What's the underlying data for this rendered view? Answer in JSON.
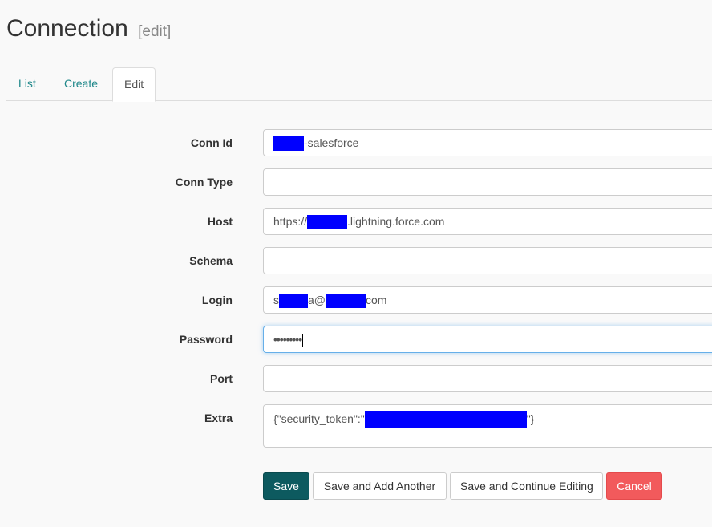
{
  "header": {
    "title": "Connection",
    "subtitle": "[edit]"
  },
  "tabs": [
    {
      "label": "List"
    },
    {
      "label": "Create"
    },
    {
      "label": "Edit"
    }
  ],
  "form": {
    "conn_id": {
      "label": "Conn Id",
      "value_suffix": "-salesforce"
    },
    "conn_type": {
      "label": "Conn Type",
      "value": ""
    },
    "host": {
      "label": "Host",
      "value_prefix": "https://",
      "value_suffix": ".lightning.force.com"
    },
    "schema": {
      "label": "Schema",
      "value": ""
    },
    "login": {
      "label": "Login",
      "value_prefix": "s",
      "value_middle": "a@",
      "value_suffix": "com"
    },
    "password": {
      "label": "Password",
      "value": "•••••••••"
    },
    "port": {
      "label": "Port",
      "value": ""
    },
    "extra": {
      "label": "Extra",
      "value_prefix": "{\"security_token\":\"",
      "value_suffix": "\"}"
    }
  },
  "buttons": {
    "save": "Save",
    "save_add": "Save and Add Another",
    "save_continue": "Save and Continue Editing",
    "cancel": "Cancel"
  },
  "colors": {
    "link": "#20888a",
    "save_button": "#0d5a5f",
    "cancel_button": "#f25a5c",
    "redaction": "#0000ff"
  }
}
